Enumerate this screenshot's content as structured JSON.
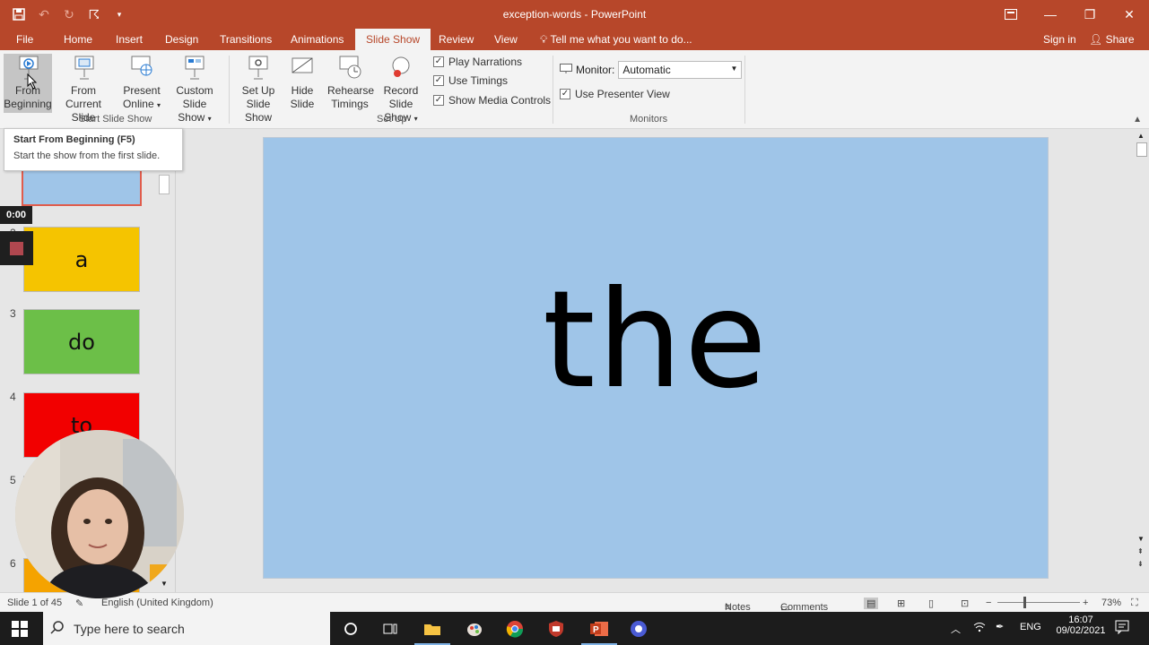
{
  "window": {
    "title": "exception-words - PowerPoint"
  },
  "qat": {
    "icons": [
      "save-icon",
      "undo-icon",
      "redo-icon",
      "touch-mode-icon",
      "customize-icon"
    ]
  },
  "tabs": [
    "File",
    "Home",
    "Insert",
    "Design",
    "Transitions",
    "Animations",
    "Slide Show",
    "Review",
    "View"
  ],
  "active_tab": "Slide Show",
  "tell_me": "Tell me what you want to do...",
  "account": {
    "sign_in": "Sign in",
    "share": "Share"
  },
  "ribbon": {
    "start_group": {
      "label": "Start Slide Show",
      "from_beginning": [
        "From",
        "Beginning"
      ],
      "from_current": [
        "From",
        "Current Slide"
      ],
      "present_online": [
        "Present",
        "Online"
      ],
      "custom_show": [
        "Custom Slide",
        "Show"
      ]
    },
    "setup_group": {
      "label": "Set Up",
      "setup_show": [
        "Set Up",
        "Slide Show"
      ],
      "hide_slide": [
        "Hide",
        "Slide"
      ],
      "rehearse": [
        "Rehearse",
        "Timings"
      ],
      "record": [
        "Record Slide",
        "Show"
      ],
      "play_narrations": "Play Narrations",
      "use_timings": "Use Timings",
      "show_media_controls": "Show Media Controls"
    },
    "monitors_group": {
      "label": "Monitors",
      "monitor_label": "Monitor:",
      "monitor_value": "Automatic",
      "presenter_view": "Use Presenter View"
    }
  },
  "tooltip": {
    "title": "Start From Beginning (F5)",
    "description": "Start the show from the first slide."
  },
  "recording": {
    "timer": "0:00"
  },
  "thumbnails": [
    {
      "num": "",
      "text": "the",
      "color": "#9fc5e8"
    },
    {
      "num": "2",
      "text": "a",
      "color": "#f5c400"
    },
    {
      "num": "3",
      "text": "do",
      "color": "#6cbf48"
    },
    {
      "num": "4",
      "text": "to",
      "color": "#f20000"
    },
    {
      "num": "5",
      "text": "",
      "color": "#9fc5e8"
    },
    {
      "num": "6",
      "text": "",
      "color": "#f5a300"
    }
  ],
  "slide": {
    "text": "the",
    "background": "#9fc5e8"
  },
  "status": {
    "slide_info": "Slide 1 of 45",
    "language": "English (United Kingdom)",
    "notes": "Notes",
    "comments": "Comments",
    "zoom": "73%"
  },
  "taskbar": {
    "search_placeholder": "Type here to search",
    "language": "ENG",
    "time": "16:07",
    "date": "09/02/2021"
  },
  "colors": {
    "accent": "#b7472a",
    "ribbon": "#f3f3f3"
  }
}
